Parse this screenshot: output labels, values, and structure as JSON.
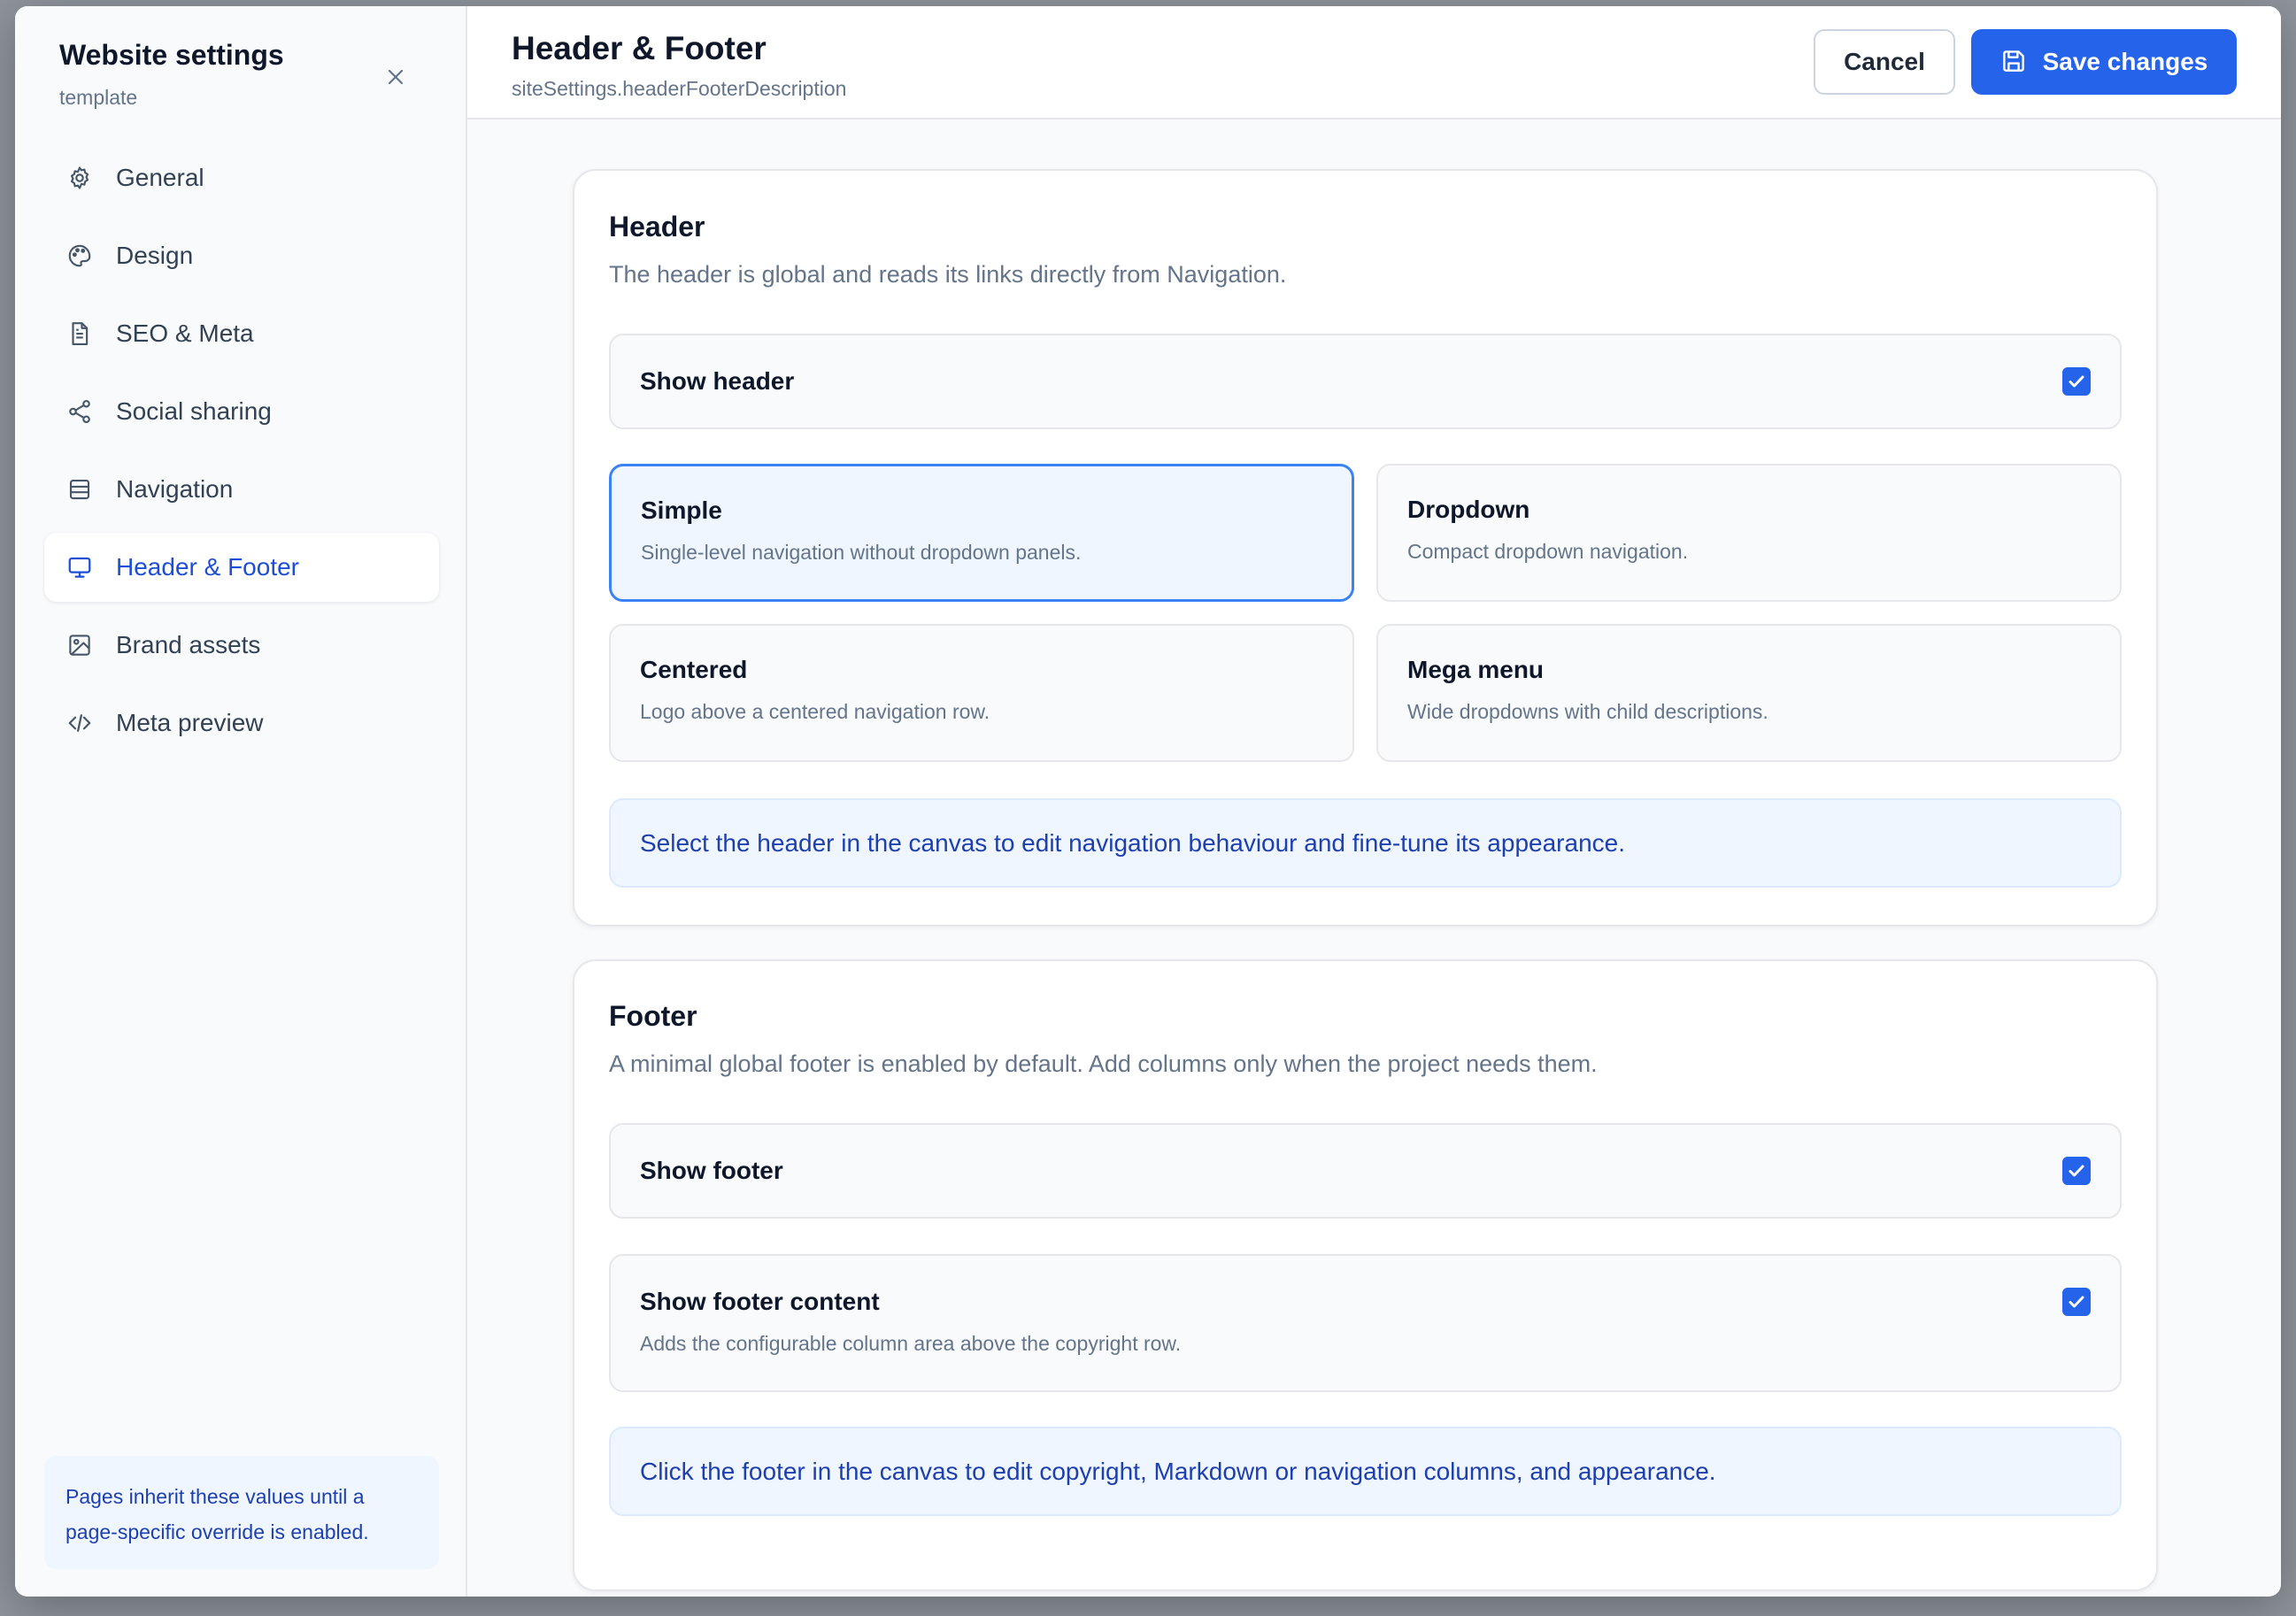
{
  "sidebar": {
    "title": "Website settings",
    "subtitle": "template",
    "items": [
      {
        "label": "General",
        "icon": "gear-icon"
      },
      {
        "label": "Design",
        "icon": "palette-icon"
      },
      {
        "label": "SEO & Meta",
        "icon": "document-icon"
      },
      {
        "label": "Social sharing",
        "icon": "share-icon"
      },
      {
        "label": "Navigation",
        "icon": "rows-icon"
      },
      {
        "label": "Header & Footer",
        "icon": "monitor-icon",
        "active": true
      },
      {
        "label": "Brand assets",
        "icon": "image-icon"
      },
      {
        "label": "Meta preview",
        "icon": "code-icon"
      }
    ],
    "note": "Pages inherit these values until a page-specific override is enabled."
  },
  "header": {
    "title": "Header & Footer",
    "description": "siteSettings.headerFooterDescription",
    "cancel_label": "Cancel",
    "save_label": "Save changes"
  },
  "header_section": {
    "title": "Header",
    "description": "The header is global and reads its links directly from Navigation.",
    "show_header": {
      "label": "Show header",
      "checked": true
    },
    "options": [
      {
        "title": "Simple",
        "description": "Single-level navigation without dropdown panels.",
        "selected": true
      },
      {
        "title": "Dropdown",
        "description": "Compact dropdown navigation.",
        "selected": false
      },
      {
        "title": "Centered",
        "description": "Logo above a centered navigation row.",
        "selected": false
      },
      {
        "title": "Mega menu",
        "description": "Wide dropdowns with child descriptions.",
        "selected": false
      }
    ],
    "info": "Select the header in the canvas to edit navigation behaviour and fine-tune its appearance."
  },
  "footer_section": {
    "title": "Footer",
    "description": "A minimal global footer is enabled by default. Add columns only when the project needs them.",
    "show_footer": {
      "label": "Show footer",
      "checked": true
    },
    "show_footer_content": {
      "label": "Show footer content",
      "help": "Adds the configurable column area above the copyright row.",
      "checked": true
    },
    "info": "Click the footer in the canvas to edit copyright, Markdown or navigation columns, and appearance."
  },
  "colors": {
    "accent": "#2563eb",
    "active_text": "#1d4ed8",
    "info_bg": "#eff6ff"
  }
}
